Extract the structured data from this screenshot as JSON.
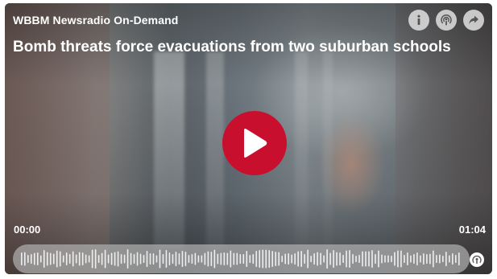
{
  "player": {
    "source_label": "WBBM Newsradio On-Demand",
    "title": "Bomb threats force evacuations from two suburban schools",
    "current_time": "00:00",
    "duration": "01:04",
    "progress": 0,
    "accent_color": "#c8102e",
    "icons": {
      "info": "info-icon",
      "podcast": "podcast-icon",
      "share": "share-icon",
      "play": "play-icon",
      "podcast_small": "podcast-icon"
    }
  }
}
